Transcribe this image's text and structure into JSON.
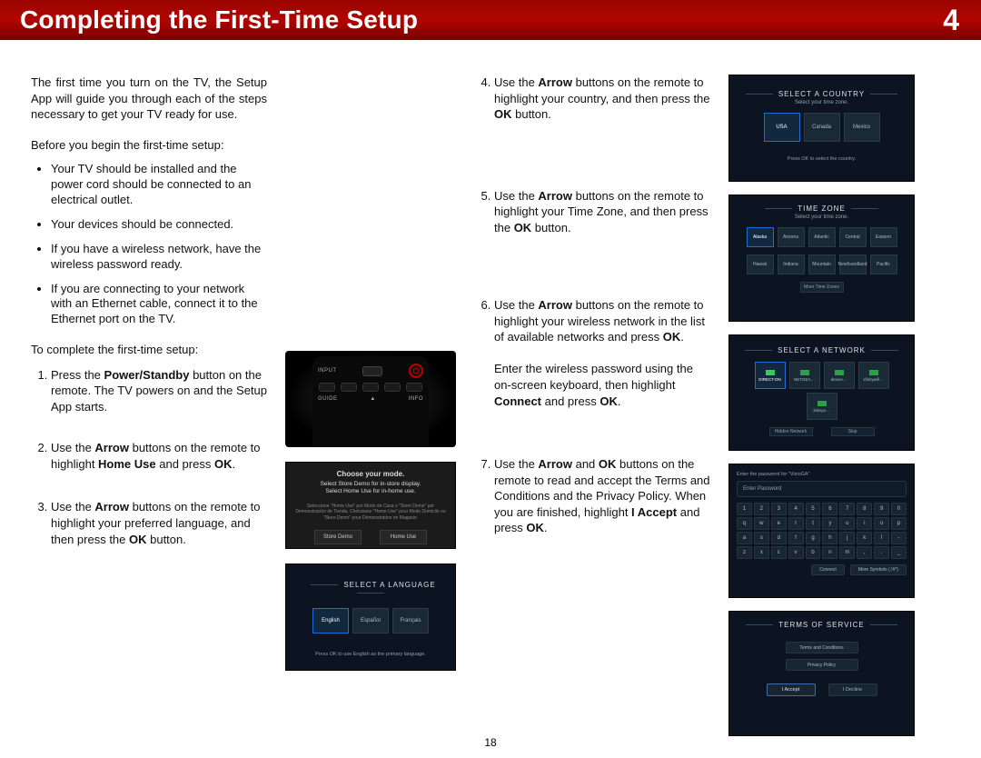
{
  "header": {
    "title": "Completing the First-Time Setup",
    "chapter": "4"
  },
  "page_number": "18",
  "intro": "The first time you turn on the TV, the Setup App will guide you through each of the steps necessary to get your TV ready for use.",
  "before_lead": "Before you begin the first-time setup:",
  "prep": [
    "Your TV should be installed and the power cord should be connected to an electrical outlet.",
    "Your devices should be connected.",
    "If you have a wireless network, have the wireless password ready.",
    "If you are connecting to your network with an Ethernet cable, connect it to the Ethernet port on the TV."
  ],
  "complete_lead": "To complete the first-time setup:",
  "steps_left": [
    {
      "pre": "Press the ",
      "b": "Power/Standby",
      "post": " button on the remote. The TV powers on and the Setup App starts."
    },
    {
      "pre": "Use the ",
      "b": "Arrow",
      "mid": " buttons on the remote to highlight ",
      "b2": "Home Use",
      "post": " and press ",
      "b3": "OK",
      "tail": "."
    },
    {
      "pre": "Use the ",
      "b": "Arrow",
      "post": " buttons on the remote to highlight your preferred language, and then press the ",
      "b2": "OK",
      "tail": " button."
    }
  ],
  "steps_right": [
    {
      "pre": "Use the ",
      "b": "Arrow",
      "post": " buttons on the remote to highlight your country, and then press the ",
      "b2": "OK",
      "tail": " button."
    },
    {
      "pre": "Use the ",
      "b": "Arrow",
      "post": " buttons on the remote to highlight your Time Zone, and then press the ",
      "b2": "OK",
      "tail": " button."
    },
    {
      "p1_pre": "Use the ",
      "p1_b": "Arrow",
      "p1_post": " buttons on the remote to highlight your wireless network in the list of available networks and press ",
      "p1_b2": "OK",
      "p1_tail": ".",
      "p2_pre": "Enter the wireless password using the on-screen keyboard, then highlight ",
      "p2_b": "Connect",
      "p2_mid": " and press ",
      "p2_b2": "OK",
      "p2_tail": "."
    },
    {
      "pre": "Use the ",
      "b": "Arrow",
      "mid": " and ",
      "b2": "OK",
      "post": " buttons on the remote to read and accept the Terms and Conditions and the Privacy Policy. When you are finished, highlight ",
      "b3": "I Accept",
      "post2": " and press ",
      "b4": "OK",
      "tail": "."
    }
  ],
  "remote": {
    "input": "INPUT",
    "guide": "GUIDE",
    "info": "INFO"
  },
  "mode": {
    "title": "Choose your mode.",
    "sub1": "Select Store Demo for in-store display.",
    "sub2": "Select Home Use for in-home use.",
    "fine": "Seleccione \"Home Use\" por Modo de Casa o \"Store Demo\" por Demonstración de Tienda. Choisissez \"Home Use\" pour Mode Domicile ou \"Store Demo\" pour Démonstration en Magasin.",
    "btns": [
      "Store Demo",
      "Home Use"
    ]
  },
  "language": {
    "title": "SELECT A LANGUAGE",
    "opts": [
      "English",
      "Español",
      "Français"
    ],
    "hint": "Press OK to use English as the primary language."
  },
  "country": {
    "title": "SELECT A COUNTRY",
    "sub": "Select your time zone.",
    "opts": [
      "USA",
      "Canada",
      "Mexico"
    ],
    "hint": "Press OK to select the country."
  },
  "timezone": {
    "title": "TIME ZONE",
    "sub": "Select your time zone.",
    "row1": [
      "Alaska",
      "Arizona",
      "Atlantic",
      "Central",
      "Eastern"
    ],
    "row2": [
      "Hawaii",
      "Indiana",
      "Mountain",
      "Newfoundland",
      "Pacific"
    ],
    "btn": "More Time Zones"
  },
  "network": {
    "title": "SELECT A NETWORK",
    "opts": [
      "DIRECT-DN",
      "NETGEA…",
      "device…",
      "xfinitywifi…",
      "linksys…"
    ],
    "btns": [
      "Hidden Network",
      "Skip"
    ]
  },
  "keyboard": {
    "top": "Enter the password for \"VizioGA\"",
    "placeholder": "Enter Password",
    "rows": [
      [
        "1",
        "2",
        "3",
        "4",
        "5",
        "6",
        "7",
        "8",
        "9",
        "0"
      ],
      [
        "q",
        "w",
        "e",
        "r",
        "t",
        "y",
        "u",
        "i",
        "o",
        "p"
      ],
      [
        "a",
        "s",
        "d",
        "f",
        "g",
        "h",
        "j",
        "k",
        "l",
        "-"
      ],
      [
        "z",
        "x",
        "c",
        "v",
        "b",
        "n",
        "m",
        ",",
        ".",
        "_"
      ]
    ],
    "bottom": [
      "Connect",
      "More Symbols (.!#*)"
    ]
  },
  "tos": {
    "title": "TERMS OF SERVICE",
    "stack": [
      "Terms and Conditions",
      "Privacy Policy"
    ],
    "actions": [
      "I Accept",
      "I Decline"
    ]
  }
}
